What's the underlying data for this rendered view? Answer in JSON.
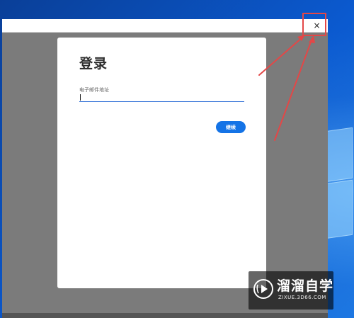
{
  "dialog": {
    "title": "登录",
    "email_label": "电子邮件地址",
    "email_value": "",
    "continue_label": "继续"
  },
  "window": {
    "close_glyph": "×"
  },
  "watermark": {
    "brand": "溜溜自学",
    "url": "ZIXUE.3D66.COM"
  },
  "colors": {
    "accent": "#1473e6",
    "annotation": "#e34747",
    "overlay": "#7b7b7b"
  }
}
